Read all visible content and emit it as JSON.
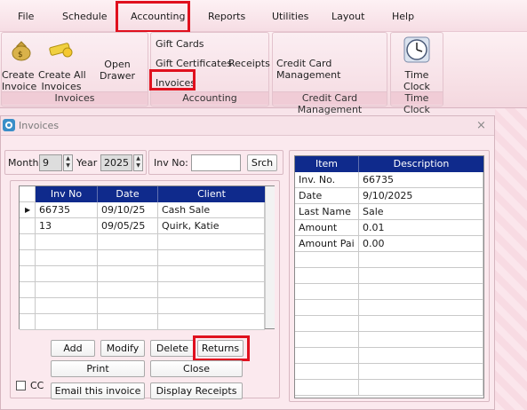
{
  "menu": {
    "file": "File",
    "schedule": "Schedule",
    "accounting": "Accounting",
    "reports": "Reports",
    "utilities": "Utilities",
    "layout": "Layout",
    "help": "Help"
  },
  "ribbon": {
    "create_invoice": "Create\nInvoice",
    "create_all_invoices": "Create All\nInvoices",
    "open_drawer": "Open Drawer",
    "invoices_group_label": "Invoices",
    "gift_cards": "Gift Cards",
    "gift_certificates": "Gift Certificates",
    "receipts": "Receipts",
    "invoices": "Invoices",
    "accounting_group_label": "Accounting",
    "credit_card_management": "Credit Card Management",
    "credit_card_group_label": "Credit Card Management",
    "time_clock": "Time Clock",
    "time_clock_group_label": "Time Clock"
  },
  "window": {
    "title": "Invoices",
    "close": "×"
  },
  "filter": {
    "month_label": "Month",
    "month_value": "9",
    "year_label": "Year",
    "year_value": "2025",
    "inv_no_label": "Inv No:",
    "inv_no_value": "",
    "search_label": "Srch"
  },
  "invoice_table": {
    "columns": [
      "Inv No",
      "Date",
      "Client"
    ],
    "rows": [
      [
        "66735",
        "09/10/25",
        "Cash Sale"
      ],
      [
        "13",
        "09/05/25",
        "Quirk, Katie"
      ]
    ]
  },
  "detail_table": {
    "columns": [
      "Item",
      "Description"
    ],
    "rows": [
      [
        "Inv. No.",
        "66735"
      ],
      [
        "Date",
        "9/10/2025"
      ],
      [
        "Last Name",
        "Sale"
      ],
      [
        "Amount",
        "0.01"
      ],
      [
        "Amount Pai",
        "0.00"
      ]
    ]
  },
  "buttons": {
    "add": "Add",
    "modify": "Modify",
    "delete": "Delete",
    "returns": "Returns",
    "print": "Print",
    "close": "Close",
    "email": "Email this invoice",
    "display_receipts": "Display Receipts",
    "cc": "CC"
  },
  "colors": {
    "grid_header": "#0f2a8c",
    "highlight": "#e0101e"
  }
}
